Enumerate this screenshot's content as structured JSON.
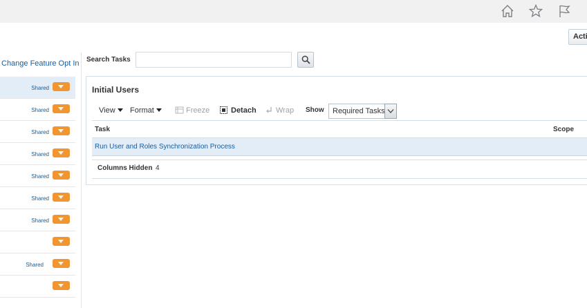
{
  "header": {
    "icons": [
      "home-icon",
      "favorites-star-icon",
      "flag-icon"
    ],
    "actions_label": "Actions"
  },
  "left_panel": {
    "opt_in_link": "Change Feature Opt In",
    "rows": [
      {
        "shared": "Shared",
        "selected": true
      },
      {
        "shared": "Shared",
        "selected": false
      },
      {
        "shared": "Shared",
        "selected": false
      },
      {
        "shared": "Shared",
        "selected": false
      },
      {
        "shared": "Shared",
        "selected": false
      },
      {
        "shared": "Shared",
        "selected": false
      },
      {
        "shared": "Shared",
        "selected": false
      },
      {
        "shared": "",
        "selected": false
      },
      {
        "shared": "Shared",
        "selected": false
      },
      {
        "shared": "",
        "selected": false
      }
    ]
  },
  "search": {
    "label": "Search Tasks",
    "value": "",
    "placeholder": ""
  },
  "panel": {
    "title": "Initial Users",
    "toolbar": {
      "view": "View",
      "format": "Format",
      "freeze": "Freeze",
      "detach": "Detach",
      "wrap": "Wrap",
      "show_label": "Show",
      "show_value": "Required Tasks"
    },
    "table": {
      "columns": [
        "Task",
        "Scope"
      ],
      "rows": [
        {
          "task": "Run User and Roles Synchronization Process",
          "scope": ""
        }
      ],
      "columns_hidden_label": "Columns Hidden",
      "columns_hidden_count": "4"
    }
  },
  "colors": {
    "link": "#145c9e",
    "accent_orange": "#f09532",
    "selected_row": "#e3edf8",
    "topbar": "#f1f1f2"
  }
}
